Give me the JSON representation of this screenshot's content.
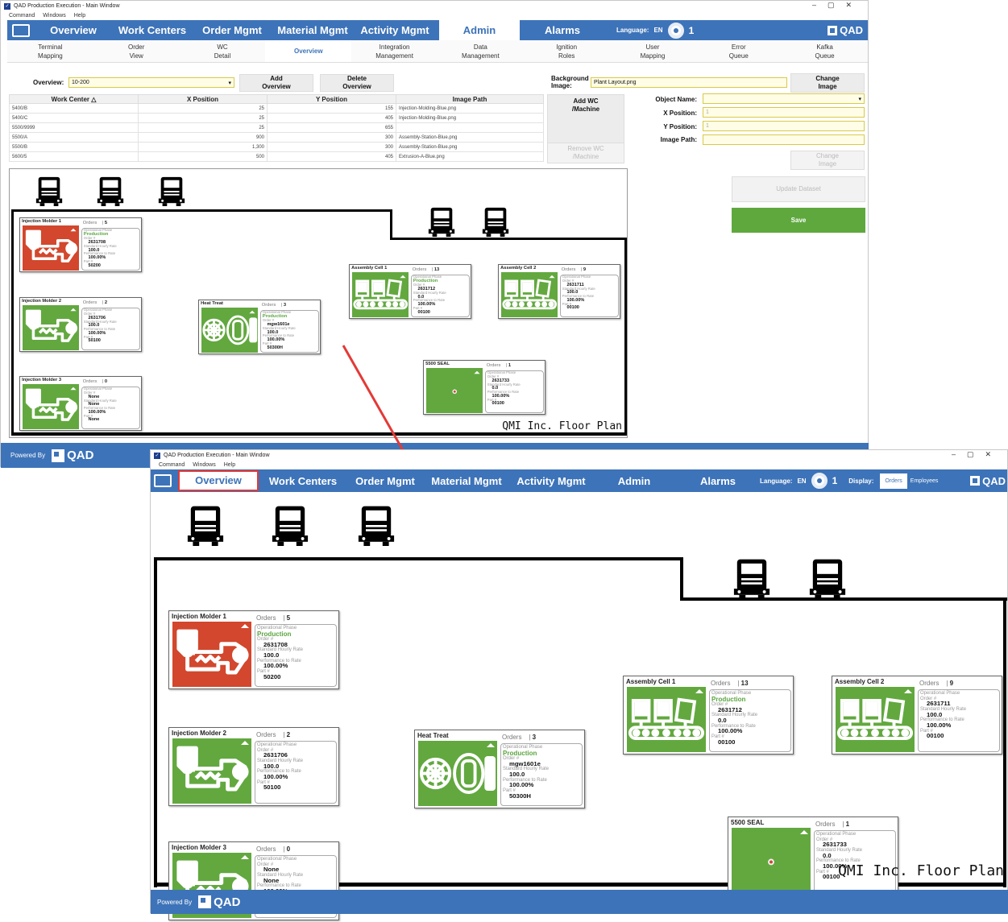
{
  "win1": {
    "title": "QAD Production Execution - Main Window",
    "menu": [
      "Command",
      "Windows",
      "Help"
    ],
    "nav": [
      "Overview",
      "Work Centers",
      "Order Mgmt",
      "Material Mgmt",
      "Activity Mgmt",
      "Admin",
      "Alarms"
    ],
    "active_nav": "Admin",
    "language_label": "Language:",
    "language": "EN",
    "alarm_count": "1",
    "logo": "QAD",
    "subnav": [
      {
        "l1": "Terminal",
        "l2": "Mapping"
      },
      {
        "l1": "Order",
        "l2": "View"
      },
      {
        "l1": "WC",
        "l2": "Detail"
      },
      {
        "l1": "Overview",
        "l2": ""
      },
      {
        "l1": "Integration",
        "l2": "Management"
      },
      {
        "l1": "Data",
        "l2": "Management"
      },
      {
        "l1": "Ignition",
        "l2": "Roles"
      },
      {
        "l1": "User",
        "l2": "Mapping"
      },
      {
        "l1": "Error",
        "l2": "Queue"
      },
      {
        "l1": "Kafka",
        "l2": "Queue"
      }
    ],
    "overview_label": "Overview:",
    "overview_value": "10-200",
    "add_overview": "Add Overview",
    "delete_overview": "Delete Overview",
    "bg_image_label": "Background Image:",
    "bg_image_value": "Plant Layout.png",
    "change_image": "Change Image",
    "table_headers": [
      "Work Center △",
      "X Position",
      "Y Position",
      "Image Path"
    ],
    "table_rows": [
      [
        "5400/B",
        "25",
        "155",
        "Injection-Molding-Blue.png"
      ],
      [
        "5400/C",
        "25",
        "405",
        "Injection-Molding-Blue.png"
      ],
      [
        "5500/9999",
        "25",
        "655",
        ""
      ],
      [
        "5500/A",
        "900",
        "300",
        "Assembly-Station-Blue.png"
      ],
      [
        "5500/B",
        "1,300",
        "300",
        "Assembly-Station-Blue.png"
      ],
      [
        "5600/5",
        "500",
        "405",
        "Extrusion-A-Blue.png"
      ]
    ],
    "add_wc": "Add WC /Machine",
    "remove_wc": "Remove WC /Machine",
    "object_name_label": "Object Name:",
    "x_pos_label": "X Position:",
    "y_pos_label": "Y Position:",
    "image_path_label": "Image Path:",
    "x_pos_value": "1",
    "y_pos_value": "1",
    "change_image2": "Change Image",
    "update_dataset": "Update Dataset",
    "save": "Save",
    "powered_by": "Powered By",
    "floor_plan": "QMI Inc. Floor Plan"
  },
  "win2": {
    "title": "QAD Production Execution - Main Window",
    "menu": [
      "Command",
      "Windows",
      "Help"
    ],
    "nav": [
      "Overview",
      "Work Centers",
      "Order Mgmt",
      "Material Mgmt",
      "Activity Mgmt",
      "Admin",
      "Alarms"
    ],
    "active_nav": "Overview",
    "language_label": "Language:",
    "language": "EN",
    "alarm_count": "1",
    "display_label": "Display:",
    "display_options": [
      "Orders",
      "Employees"
    ],
    "display_selected": "Orders",
    "logo": "QAD",
    "powered_by": "Powered By",
    "floor_plan": "QMI Inc. Floor Plan"
  },
  "labels": {
    "orders": "Orders",
    "op_phase": "Operational Phase",
    "order_no": "Order #",
    "std_rate": "Standard Hourly Rate",
    "perf_rate": "Performance to Rate",
    "part_no": "Part #"
  },
  "work_centers": [
    {
      "name": "Injection Molder 1",
      "orders": "5",
      "phase": "Production",
      "order": "2631708",
      "rate": "100.0",
      "perf": "100.00%",
      "part": "50200",
      "color": "#d2472d",
      "kind": "molder"
    },
    {
      "name": "Injection Molder 2",
      "orders": "2",
      "phase": "",
      "order": "2631706",
      "rate": "100.0",
      "perf": "100.00%",
      "part": "50100",
      "color": "#62a83f",
      "kind": "molder"
    },
    {
      "name": "Injection Molder 3",
      "orders": "0",
      "phase": "",
      "order": "None",
      "rate": "None",
      "perf": "100.00%",
      "part": "None",
      "color": "#62a83f",
      "kind": "molder"
    },
    {
      "name": "Heat Treat",
      "orders": "3",
      "phase": "Production",
      "order": "mgw1601e",
      "rate": "100.0",
      "perf": "100.00%",
      "part": "50300H",
      "color": "#62a83f",
      "kind": "heat"
    },
    {
      "name": "Assembly Cell 1",
      "orders": "13",
      "phase": "Production",
      "order": "2631712",
      "rate": "0.0",
      "perf": "100.00%",
      "part": "00100",
      "color": "#62a83f",
      "kind": "assembly"
    },
    {
      "name": "Assembly Cell 2",
      "orders": "9",
      "phase": "",
      "order": "2631711",
      "rate": "100.0",
      "perf": "100.00%",
      "part": "00100",
      "color": "#62a83f",
      "kind": "assembly"
    },
    {
      "name": "5500 SEAL",
      "orders": "1",
      "phase": "",
      "order": "2631733",
      "rate": "0.0",
      "perf": "100.00%",
      "part": "00100",
      "color": "#62a83f",
      "kind": "seal"
    }
  ]
}
